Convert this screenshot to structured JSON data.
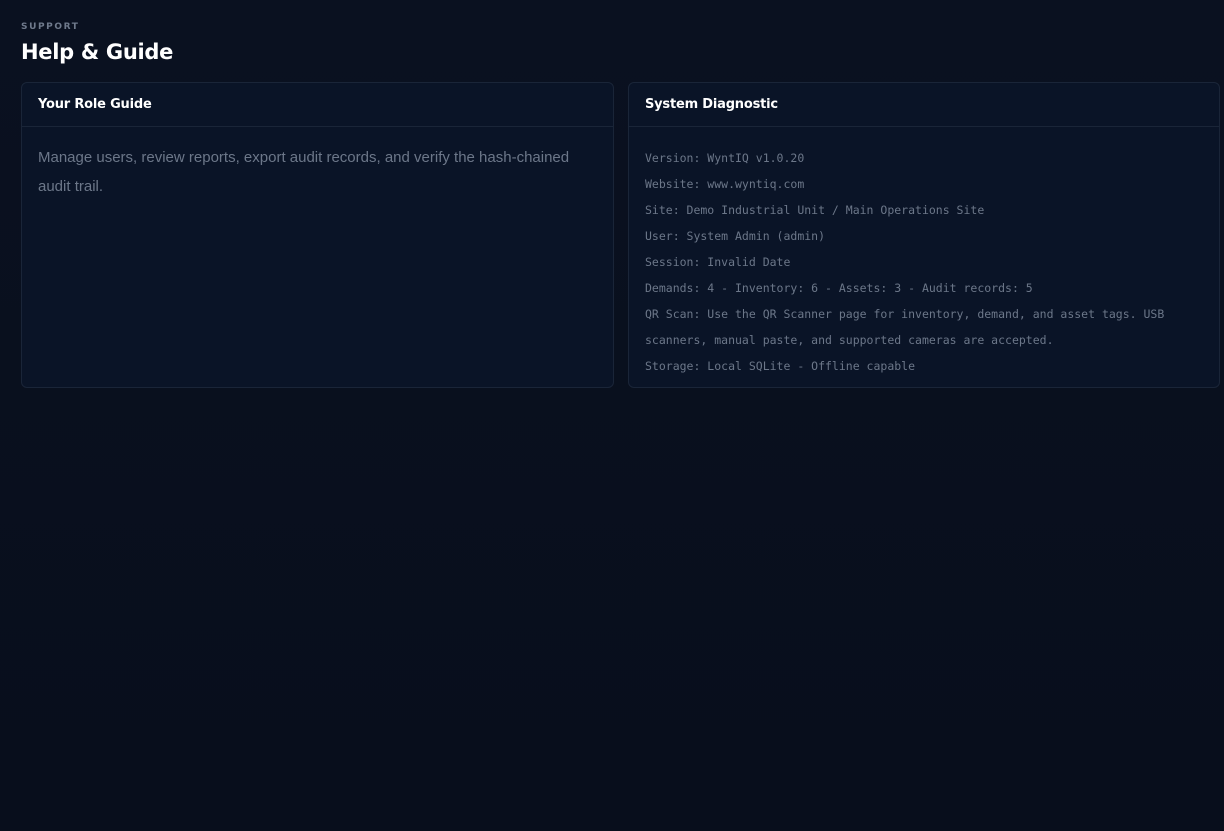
{
  "header": {
    "eyebrow": "SUPPORT",
    "title": "Help & Guide"
  },
  "role_guide": {
    "title": "Your Role Guide",
    "text": "Manage users, review reports, export audit records, and verify the hash-chained audit trail."
  },
  "diagnostic": {
    "title": "System Diagnostic",
    "lines": [
      "Version: WyntIQ v1.0.20",
      "Website: www.wyntiq.com",
      "Site: Demo Industrial Unit / Main Operations Site",
      "User: System Admin (admin)",
      "Session: Invalid Date",
      "Demands: 4 - Inventory: 6 - Assets: 3 - Audit records: 5",
      "QR Scan: Use the QR Scanner page for inventory, demand, and asset tags. USB scanners, manual paste, and supported cameras are accepted.",
      "Storage: Local SQLite - Offline capable"
    ]
  }
}
